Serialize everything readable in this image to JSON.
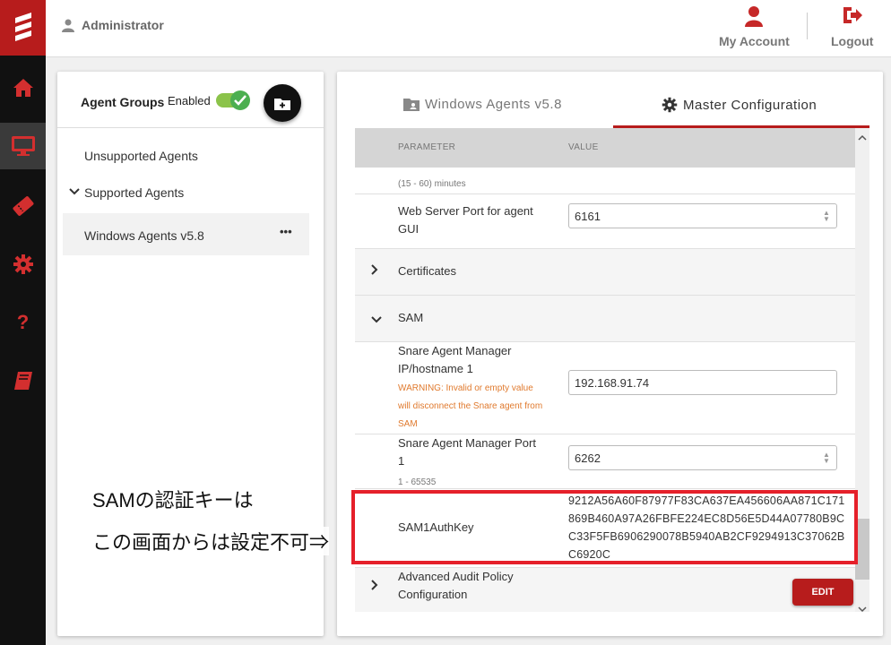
{
  "topbar": {
    "user_name": "Administrator",
    "my_account_label": "My Account",
    "logout_label": "Logout"
  },
  "nav": {
    "items": [
      "home-icon",
      "monitor-icon",
      "ticket-icon",
      "gear-icon",
      "help-icon",
      "book-icon"
    ],
    "active": "monitor-icon"
  },
  "agent_groups": {
    "title": "Agent Groups",
    "enabled_label": "Enabled",
    "enabled": true,
    "items": {
      "unsupported": "Unsupported Agents",
      "supported": "Supported Agents",
      "selected": "Windows Agents v5.8",
      "more": "•••"
    }
  },
  "tabs": {
    "windows_agents": "Windows Agents v5.8",
    "master_config": "Master Configuration",
    "active": "master_config"
  },
  "table": {
    "col_parameter": "PARAMETER",
    "col_value": "VALUE",
    "partial_hint": "(15 - 60) minutes",
    "web_port_label": "Web Server Port for agent GUI",
    "web_port_value": "6161",
    "certificates": "Certificates",
    "sam": "SAM",
    "sam_host_label": "Snare Agent Manager IP/hostname 1",
    "sam_host_warning": "WARNING: Invalid or empty value will disconnect the Snare agent from SAM",
    "sam_host_value": "192.168.91.74",
    "sam_port_label": "Snare Agent Manager Port 1",
    "sam_port_hint": "1 - 65535",
    "sam_port_value": "6262",
    "authkey_label": "SAM1AuthKey",
    "authkey_value": "9212A56A60F87977F83CA637EA456606AA871C171869B460A97A26FBFE224EC8D56E5D44A07780B9CC33F5FB6906290078B5940AB2CF9294913C37062BC6920C",
    "advanced_label": "Advanced Audit Policy Configuration",
    "edit_label": "EDIT"
  },
  "annotation": {
    "line1": "SAMの認証キーは",
    "line2": "この画面からは設定不可⇒"
  },
  "colors": {
    "brand_red": "#b71c1c",
    "toggle_green": "#4caf50",
    "warning_orange": "#e07a2e",
    "annotation_red": "#e5202a"
  }
}
